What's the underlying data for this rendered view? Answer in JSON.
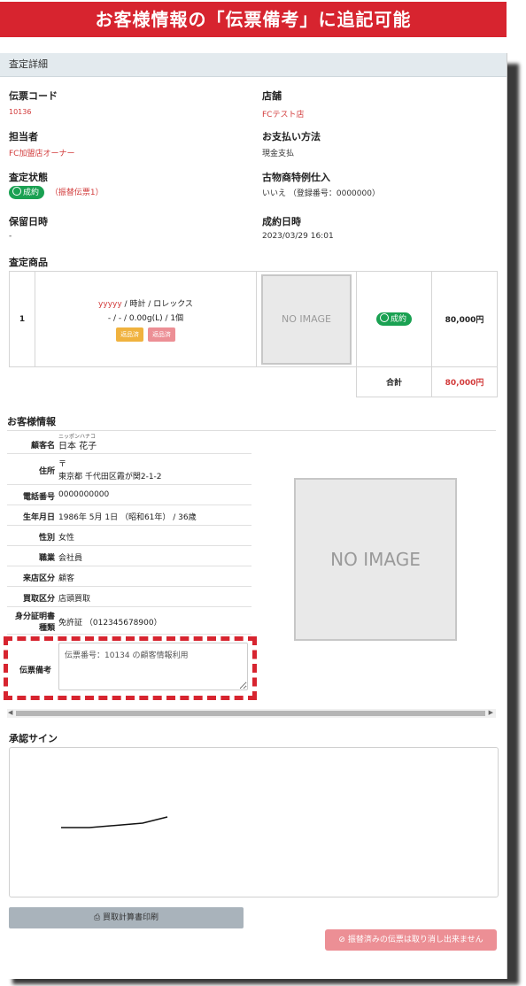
{
  "banner": {
    "title": "お客様情報の「伝票備考」に追記可能"
  },
  "panel": {
    "header": "査定詳細"
  },
  "fields": {
    "slip_code": {
      "label": "伝票コード",
      "value": "10136"
    },
    "store": {
      "label": "店舗",
      "value": "FCテスト店"
    },
    "staff": {
      "label": "担当者",
      "value": "FC加盟店オーナー"
    },
    "payment": {
      "label": "お支払い方法",
      "value": "現金支払"
    },
    "status": {
      "label": "査定状態",
      "badge": "成約",
      "note": "（振替伝票1）"
    },
    "antique": {
      "label": "古物商特例仕入",
      "value": "いいえ （登録番号：0000000）"
    },
    "hold_date": {
      "label": "保留日時",
      "value": "-"
    },
    "contract_date": {
      "label": "成約日時",
      "value": "2023/03/29 16:01"
    }
  },
  "items_section": {
    "title": "査定商品",
    "rows": [
      {
        "no": "1",
        "desc_line1_name": "yyyyy",
        "desc_line1_rest": " / 時計 / ロレックス",
        "desc_line2": "- / - / 0.00g(L) / 1個",
        "btn_return": "返品済",
        "btn_return2": "返品済",
        "image_text": "NO IMAGE",
        "status_badge": "成約",
        "price": "80,000円"
      }
    ],
    "total_label": "合計",
    "total_value": "80,000円"
  },
  "customer": {
    "title": "お客様情報",
    "rows": [
      {
        "k": "顧客名",
        "ruby": "ニッポンハナコ",
        "v": "日本 花子"
      },
      {
        "k": "住所",
        "v1": "〒",
        "v2": "東京都 千代田区霞が関2-1-2"
      },
      {
        "k": "電話番号",
        "v": "0000000000"
      },
      {
        "k": "生年月日",
        "v": "1986年 5月 1日 （昭和61年） / 36歳"
      },
      {
        "k": "性別",
        "v": "女性"
      },
      {
        "k": "職業",
        "v": "会社員"
      },
      {
        "k": "来店区分",
        "v": "顧客"
      },
      {
        "k": "買取区分",
        "v": "店頭買取"
      },
      {
        "k1": "身分証明書",
        "k2": "種類",
        "v": "免許証 （012345678900）"
      }
    ],
    "remarks_label": "伝票備考",
    "remarks_value": "伝票番号：10134 の顧客情報利用",
    "image_text": "NO IMAGE"
  },
  "sign": {
    "title": "承認サイン"
  },
  "buttons": {
    "print": "買取計算書印刷",
    "cancel": "振替済みの伝票は取り消し出来ません"
  },
  "colors": {
    "accent_red": "#d7242f",
    "success_green": "#1aa152"
  }
}
